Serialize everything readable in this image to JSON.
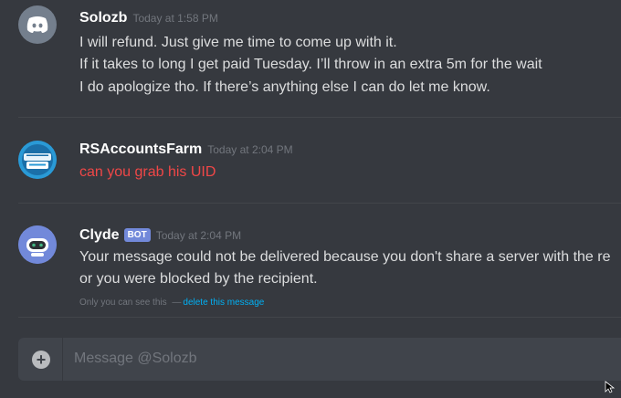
{
  "messages": [
    {
      "username": "Solozb",
      "timestamp": "Today at 1:58 PM",
      "lines": [
        "I will refund. Just give me time to come up with it.",
        "If it takes to long I get paid Tuesday. I’ll throw in an extra 5m for the wait",
        "I do apologize tho. If there’s anything else I can do let me know."
      ],
      "avatar_icon": "discord-logo-icon"
    },
    {
      "username": "RSAccountsFarm",
      "timestamp": "Today at 2:04 PM",
      "lines": [
        "can you grab his UID"
      ],
      "text_color": "#f04747",
      "avatar_icon": "rs-accounts-farm-avatar"
    },
    {
      "username": "Clyde",
      "badge": "BOT",
      "timestamp": "Today at 2:04 PM",
      "lines": [
        "Your message could not be delivered because you don't share a server with the re",
        "or you were blocked by the recipient."
      ],
      "ephemeral_note": "Only you can see this",
      "ephemeral_sep": "—",
      "delete_link": "delete this message",
      "avatar_icon": "clyde-bot-icon"
    }
  ],
  "composer": {
    "placeholder": "Message @Solozb",
    "attach_icon": "plus-circle-icon"
  },
  "colors": {
    "background": "#36393f",
    "input": "#40444b",
    "blurple": "#7289da",
    "link": "#00b0f4",
    "error_red": "#f04747"
  }
}
